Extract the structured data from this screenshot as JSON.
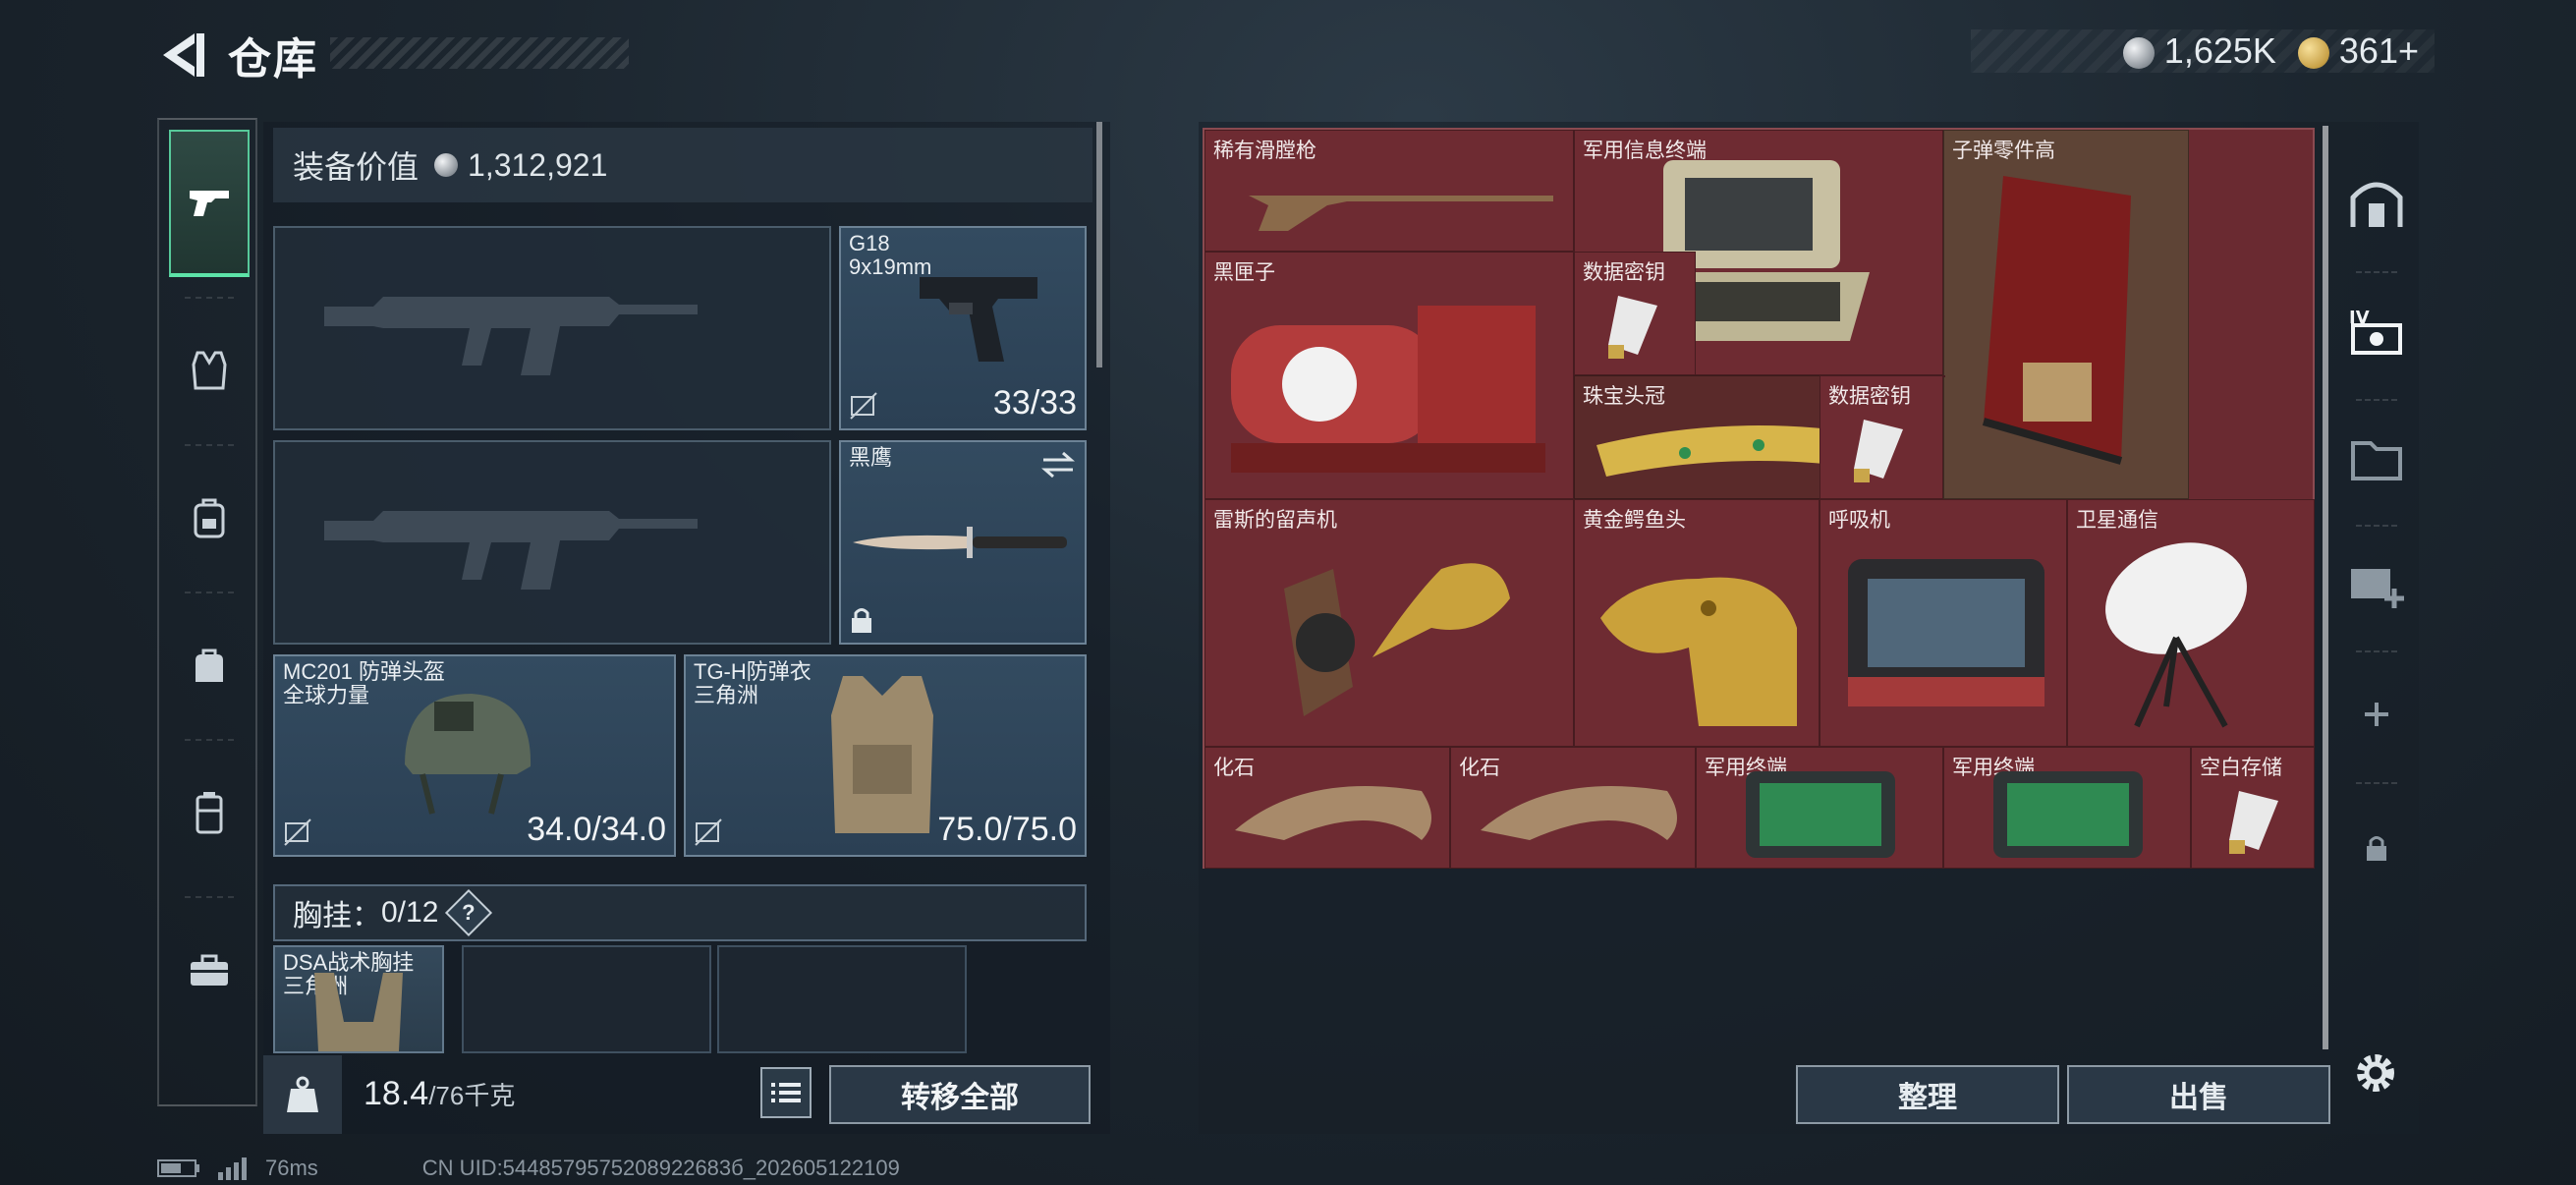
{
  "header": {
    "title": "仓库",
    "currencies": [
      {
        "icon": "silver-coin-icon",
        "value": "1,625K"
      },
      {
        "icon": "gold-coin-icon",
        "value": "361+"
      }
    ]
  },
  "left_rail": [
    {
      "name": "weapons",
      "icon": "pistol-icon",
      "active": true
    },
    {
      "name": "armor",
      "icon": "vest-icon"
    },
    {
      "name": "backpack",
      "icon": "backpack-icon"
    },
    {
      "name": "bag",
      "icon": "bag-icon"
    },
    {
      "name": "containers",
      "icon": "canister-icon"
    },
    {
      "name": "toolbox",
      "icon": "toolbox-icon"
    }
  ],
  "equipment": {
    "value_label": "装备价值",
    "value": "1,312,921",
    "sidearm": {
      "name": "G18",
      "ammo": "9x19mm",
      "count": "33/33"
    },
    "melee": {
      "name": "黑鹰"
    },
    "helmet": {
      "name": "MC201 防弹头盔",
      "brand": "全球力量",
      "durability": "34.0/34.0"
    },
    "armor": {
      "name": "TG-H防弹衣",
      "brand": "三角洲",
      "durability": "75.0/75.0"
    },
    "chest_rig": {
      "label": "胸挂：",
      "count": "0/12",
      "help": "?"
    },
    "rig_item": {
      "name": "DSA战术胸挂",
      "brand": "三角洲"
    }
  },
  "footer_left": {
    "weight_value": "18.4",
    "weight_max": "/76千克",
    "transfer_all": "转移全部"
  },
  "storage": {
    "items": [
      {
        "label": "稀有滑膛枪"
      },
      {
        "label": "军用信息终端"
      },
      {
        "label": "子弹零件高"
      },
      {
        "label": "黑匣子"
      },
      {
        "label": "数据密钥"
      },
      {
        "label": "珠宝头冠"
      },
      {
        "label": "数据密钥"
      },
      {
        "label": "雷斯的留声机"
      },
      {
        "label": "黄金鳄鱼头"
      },
      {
        "label": "呼吸机"
      },
      {
        "label": "卫星通信"
      },
      {
        "label": "化石"
      },
      {
        "label": "化石"
      },
      {
        "label": "军用终端"
      },
      {
        "label": "军用终端"
      },
      {
        "label": "空白存储"
      }
    ],
    "sort": "整理",
    "sell": "出售"
  },
  "right_rail": [
    {
      "icon": "safe-box-icon"
    },
    {
      "icon": "storage-tier-icon"
    },
    {
      "icon": "folder-icon"
    },
    {
      "icon": "expand-storage-icon"
    },
    {
      "icon": "plus-icon"
    },
    {
      "icon": "lock-icon"
    }
  ],
  "status_bar": {
    "ping": "76ms",
    "uid": "CN UID:5448579575208922683б_202605122109"
  }
}
